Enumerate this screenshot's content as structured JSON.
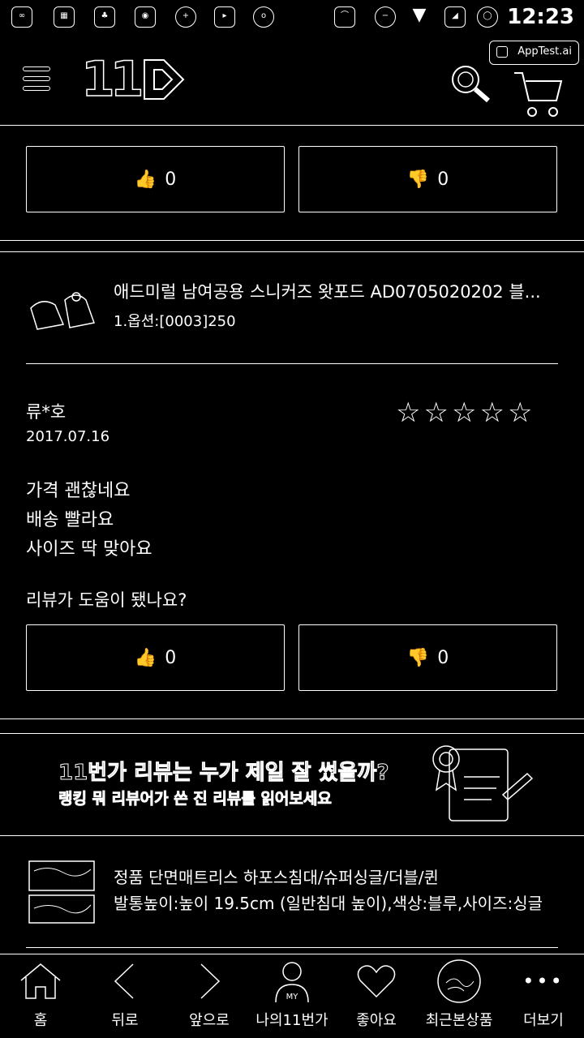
{
  "status_bar": {
    "time": "12:23",
    "left_icons": [
      "podcast-icon",
      "calendar-icon",
      "leaf-icon",
      "gamepad-icon",
      "clock-icon",
      "shopping-bag-icon",
      "settings-icon"
    ],
    "right_icons": [
      "cast-icon",
      "do-not-disturb-icon",
      "wifi-icon",
      "signal-icon",
      "battery-icon"
    ]
  },
  "watermark": {
    "label": "AppTest.ai"
  },
  "header": {
    "logo": "11"
  },
  "review_top": {
    "like_count": "0",
    "dislike_count": "0"
  },
  "review": {
    "product_name": "애드미럴 남여공용 스니커즈 왓포드 AD0705020202 블...",
    "option": "1.옵션:[0003]250",
    "author": "류*호",
    "date": "2017.07.16",
    "rating": 0,
    "body_lines": [
      "가격 괜찮네요",
      "배송 빨라요",
      "사이즈 딱 맞아요"
    ],
    "helpful_question": "리뷰가 도움이 됐나요?",
    "like_count": "0",
    "dislike_count": "0"
  },
  "banner": {
    "title": "11번가 리뷰는 누가 제일 잘 썼을까?",
    "subtitle": "랭킹 뭐 리뷰어가 쓴 진 리뷰를 읽어보세요"
  },
  "next_product": {
    "line1": "정품 단면매트리스 하포스침대/슈퍼싱글/더블/퀸",
    "line2": "발통높이:높이 19.5cm (일반침대 높이),색상:블루,사이즈:싱글"
  },
  "bottom_nav": {
    "items": [
      {
        "label": "홈",
        "icon": "home-icon"
      },
      {
        "label": "뒤로",
        "icon": "back-icon"
      },
      {
        "label": "앞으로",
        "icon": "forward-icon"
      },
      {
        "label": "나의11번가",
        "icon": "my-icon"
      },
      {
        "label": "좋아요",
        "icon": "heart-icon"
      },
      {
        "label": "최근본상품",
        "icon": "recent-icon"
      },
      {
        "label": "더보기",
        "icon": "more-icon"
      }
    ]
  },
  "colors": {
    "background": "#000000",
    "foreground": "#ffffff"
  }
}
